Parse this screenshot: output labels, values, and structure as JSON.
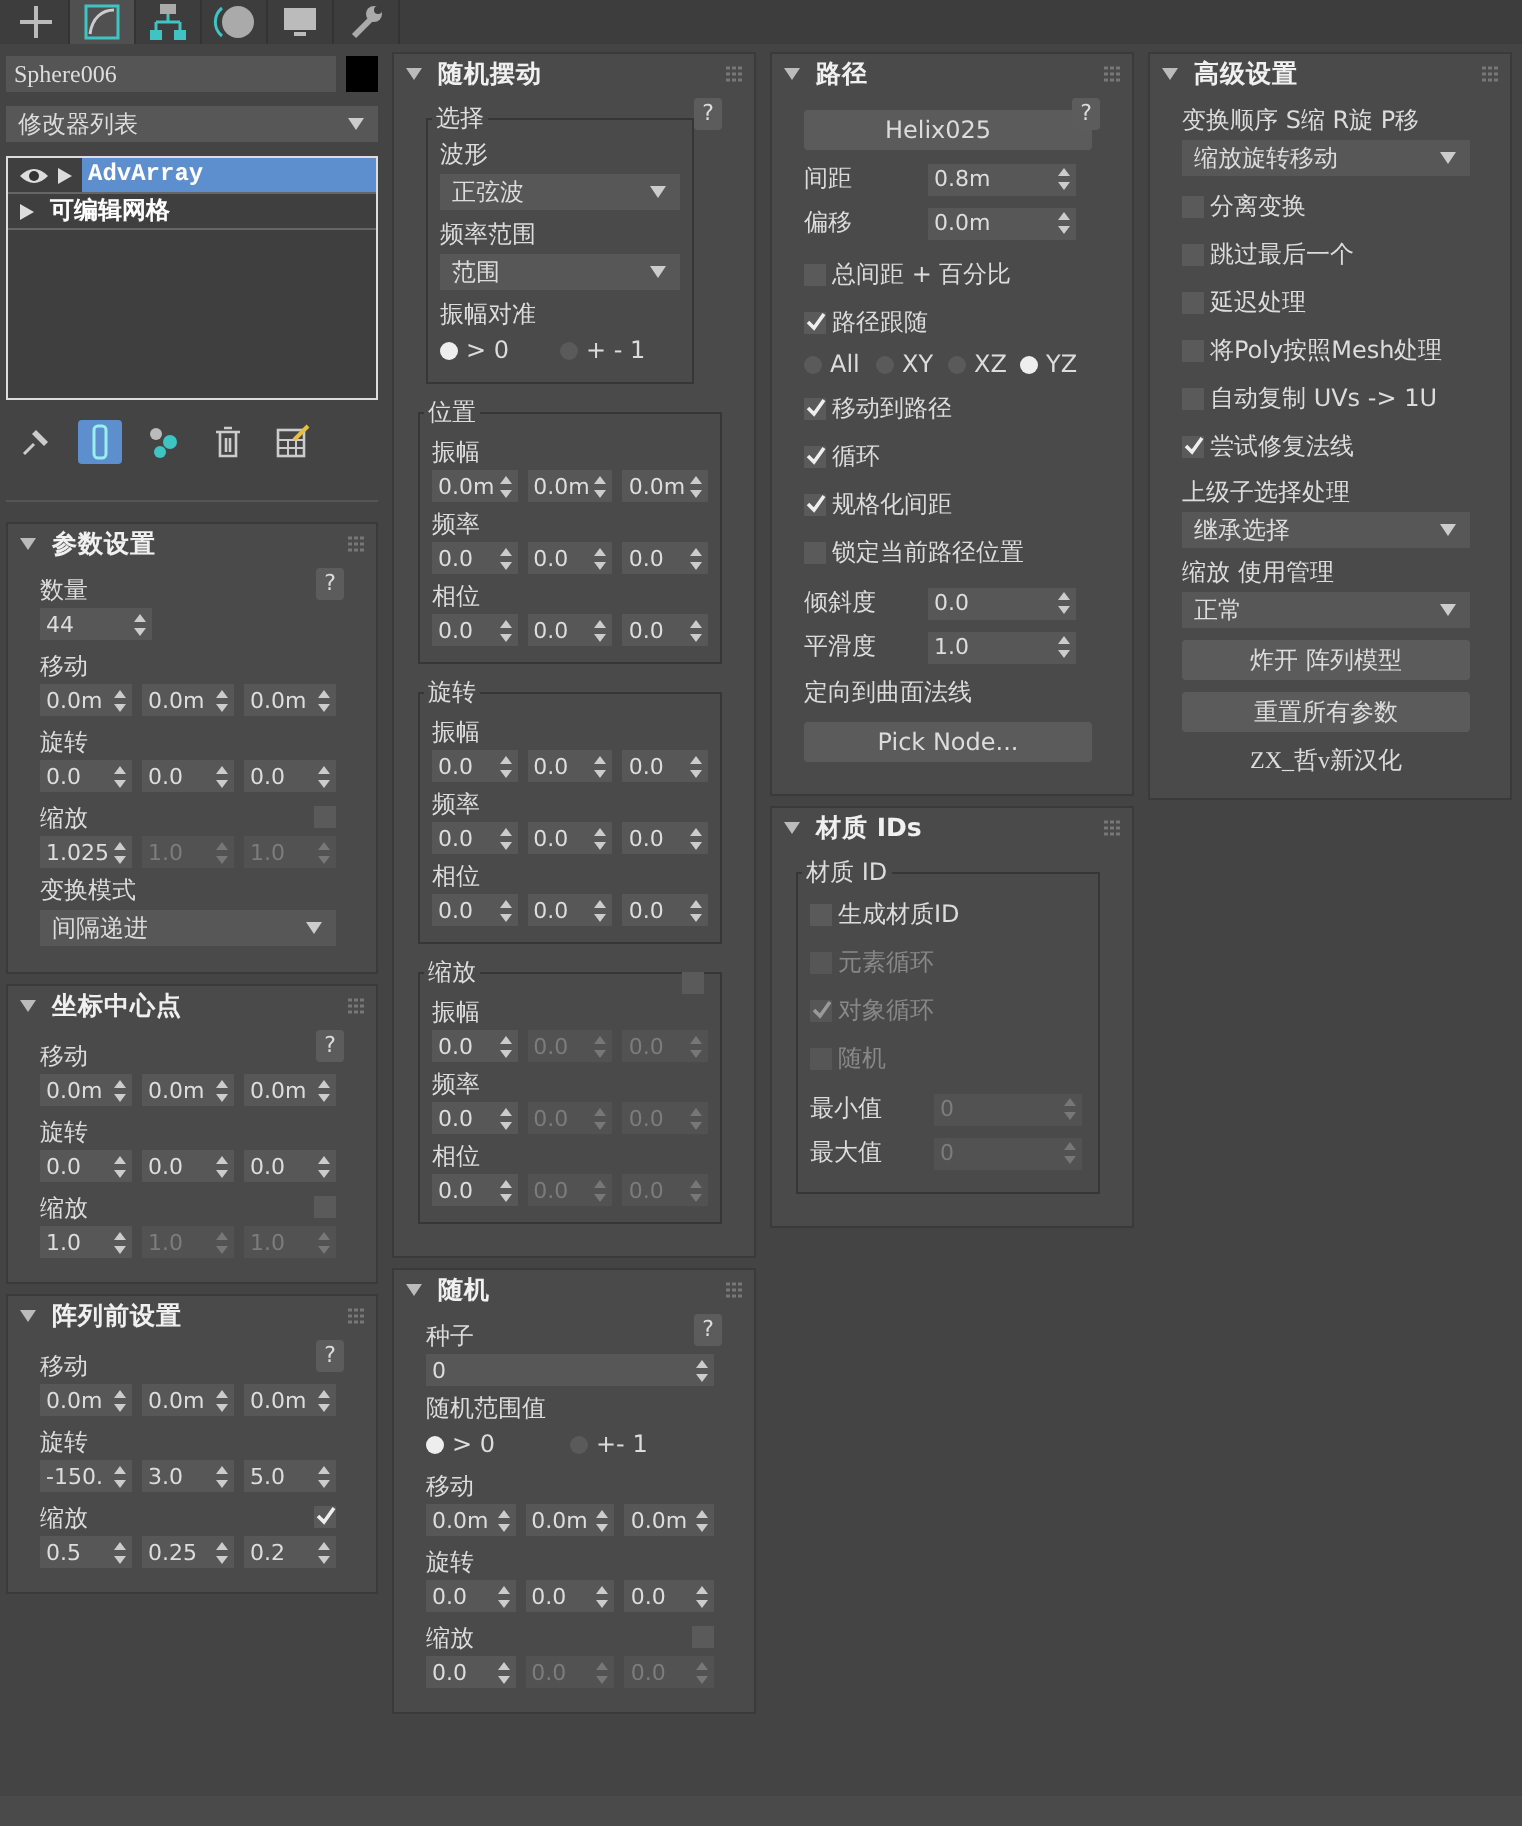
{
  "tabs": [
    {
      "kind": "create",
      "selected": false
    },
    {
      "kind": "modify",
      "selected": true
    },
    {
      "kind": "hierarchy",
      "selected": false
    },
    {
      "kind": "motion",
      "selected": false
    },
    {
      "kind": "display",
      "selected": false
    },
    {
      "kind": "utilities",
      "selected": false
    }
  ],
  "object_name": "Sphere006",
  "modifier_list": "修改器列表",
  "stack": [
    {
      "kind": "modifier",
      "label": "AdvArray",
      "selected": true
    },
    {
      "kind": "object",
      "label": "可编辑网格",
      "selected": false
    }
  ],
  "stack_tools": [
    {
      "kind": "pin",
      "on": false
    },
    {
      "kind": "end-result",
      "on": true
    },
    {
      "kind": "unique",
      "on": false
    },
    {
      "kind": "remove",
      "on": false
    },
    {
      "kind": "configure",
      "on": false
    }
  ],
  "columns": [
    {
      "rollouts": [
        {
          "title": "参数设置",
          "help": "?",
          "items": [
            {
              "kind": "spinner",
              "label": "数量",
              "value": "44"
            },
            {
              "kind": "spin3",
              "label": "移动",
              "fields": [
                {
                  "value": "0.0m",
                  "disabled": false
                },
                {
                  "value": "0.0m",
                  "disabled": false
                },
                {
                  "value": "0.0m",
                  "disabled": false
                }
              ]
            },
            {
              "kind": "spin3",
              "label": "旋转",
              "fields": [
                {
                  "value": "0.0",
                  "disabled": false
                },
                {
                  "value": "0.0",
                  "disabled": false
                },
                {
                  "value": "0.0",
                  "disabled": false
                }
              ]
            },
            {
              "kind": "spin3",
              "label": "缩放",
              "checked": false,
              "fields": [
                {
                  "value": "1.025",
                  "disabled": false
                },
                {
                  "value": "1.0",
                  "disabled": true
                },
                {
                  "value": "1.0",
                  "disabled": true
                }
              ]
            },
            {
              "kind": "dropdown",
              "label": "变换模式",
              "value": "间隔递进"
            }
          ]
        },
        {
          "title": "坐标中心点",
          "help": "?",
          "items": [
            {
              "kind": "spin3",
              "label": "移动",
              "fields": [
                {
                  "value": "0.0m",
                  "disabled": false
                },
                {
                  "value": "0.0m",
                  "disabled": false
                },
                {
                  "value": "0.0m",
                  "disabled": false
                }
              ]
            },
            {
              "kind": "spin3",
              "label": "旋转",
              "fields": [
                {
                  "value": "0.0",
                  "disabled": false
                },
                {
                  "value": "0.0",
                  "disabled": false
                },
                {
                  "value": "0.0",
                  "disabled": false
                }
              ]
            },
            {
              "kind": "spin3",
              "label": "缩放",
              "checked": false,
              "fields": [
                {
                  "value": "1.0",
                  "disabled": false
                },
                {
                  "value": "1.0",
                  "disabled": true
                },
                {
                  "value": "1.0",
                  "disabled": true
                }
              ]
            }
          ]
        },
        {
          "title": "阵列前设置",
          "help": "?",
          "items": [
            {
              "kind": "spin3",
              "label": "移动",
              "fields": [
                {
                  "value": "0.0m",
                  "disabled": false
                },
                {
                  "value": "0.0m",
                  "disabled": false
                },
                {
                  "value": "0.0m",
                  "disabled": false
                }
              ]
            },
            {
              "kind": "spin3",
              "label": "旋转",
              "fields": [
                {
                  "value": "-150.",
                  "disabled": false
                },
                {
                  "value": "3.0",
                  "disabled": false
                },
                {
                  "value": "5.0",
                  "disabled": false
                }
              ]
            },
            {
              "kind": "spin3",
              "label": "缩放",
              "checked": true,
              "fields": [
                {
                  "value": "0.5",
                  "disabled": false
                },
                {
                  "value": "0.25",
                  "disabled": false
                },
                {
                  "value": "0.2",
                  "disabled": false
                }
              ]
            }
          ]
        }
      ]
    },
    {
      "rollouts": [
        {
          "title": "随机摆动",
          "help": "?",
          "items": [
            {
              "kind": "group",
              "title": "选择",
              "items": [
                {
                  "kind": "label",
                  "text": "波形"
                },
                {
                  "kind": "dropdown",
                  "value": "正弦波"
                },
                {
                  "kind": "label",
                  "text": "频率范围"
                },
                {
                  "kind": "dropdown",
                  "value": "范围"
                },
                {
                  "kind": "label",
                  "text": "振幅对准"
                },
                {
                  "kind": "radios",
                  "options": [
                    {
                      "label": "> 0",
                      "selected": true
                    },
                    {
                      "label": "+ - 1",
                      "selected": false
                    }
                  ]
                }
              ]
            },
            {
              "kind": "group",
              "title": "位置",
              "items": [
                {
                  "kind": "spin3",
                  "label": "振幅",
                  "fields": [
                    {
                      "value": "0.0m",
                      "disabled": false
                    },
                    {
                      "value": "0.0m",
                      "disabled": false
                    },
                    {
                      "value": "0.0m",
                      "disabled": false
                    }
                  ]
                },
                {
                  "kind": "spin3",
                  "label": "频率",
                  "fields": [
                    {
                      "value": "0.0",
                      "disabled": false
                    },
                    {
                      "value": "0.0",
                      "disabled": false
                    },
                    {
                      "value": "0.0",
                      "disabled": false
                    }
                  ]
                },
                {
                  "kind": "spin3",
                  "label": "相位",
                  "fields": [
                    {
                      "value": "0.0",
                      "disabled": false
                    },
                    {
                      "value": "0.0",
                      "disabled": false
                    },
                    {
                      "value": "0.0",
                      "disabled": false
                    }
                  ]
                }
              ]
            },
            {
              "kind": "group",
              "title": "旋转",
              "items": [
                {
                  "kind": "spin3",
                  "label": "振幅",
                  "fields": [
                    {
                      "value": "0.0",
                      "disabled": false
                    },
                    {
                      "value": "0.0",
                      "disabled": false
                    },
                    {
                      "value": "0.0",
                      "disabled": false
                    }
                  ]
                },
                {
                  "kind": "spin3",
                  "label": "频率",
                  "fields": [
                    {
                      "value": "0.0",
                      "disabled": false
                    },
                    {
                      "value": "0.0",
                      "disabled": false
                    },
                    {
                      "value": "0.0",
                      "disabled": false
                    }
                  ]
                },
                {
                  "kind": "spin3",
                  "label": "相位",
                  "fields": [
                    {
                      "value": "0.0",
                      "disabled": false
                    },
                    {
                      "value": "0.0",
                      "disabled": false
                    },
                    {
                      "value": "0.0",
                      "disabled": false
                    }
                  ]
                }
              ]
            },
            {
              "kind": "group",
              "title": "缩放",
              "checked": false,
              "items": [
                {
                  "kind": "spin3",
                  "label": "振幅",
                  "fields": [
                    {
                      "value": "0.0",
                      "disabled": false
                    },
                    {
                      "value": "0.0",
                      "disabled": true
                    },
                    {
                      "value": "0.0",
                      "disabled": true
                    }
                  ]
                },
                {
                  "kind": "spin3",
                  "label": "频率",
                  "fields": [
                    {
                      "value": "0.0",
                      "disabled": false
                    },
                    {
                      "value": "0.0",
                      "disabled": true
                    },
                    {
                      "value": "0.0",
                      "disabled": true
                    }
                  ]
                },
                {
                  "kind": "spin3",
                  "label": "相位",
                  "fields": [
                    {
                      "value": "0.0",
                      "disabled": false
                    },
                    {
                      "value": "0.0",
                      "disabled": true
                    },
                    {
                      "value": "0.0",
                      "disabled": true
                    }
                  ]
                }
              ]
            }
          ]
        },
        {
          "title": "随机",
          "help": "?",
          "items": [
            {
              "kind": "spinner_wide",
              "label": "种子",
              "value": "0"
            },
            {
              "kind": "label",
              "text": "随机范围值"
            },
            {
              "kind": "radios",
              "options": [
                {
                  "label": "> 0",
                  "selected": true
                },
                {
                  "label": "+- 1",
                  "selected": false
                }
              ]
            },
            {
              "kind": "spin3",
              "label": "移动",
              "fields": [
                {
                  "value": "0.0m",
                  "disabled": false
                },
                {
                  "value": "0.0m",
                  "disabled": false
                },
                {
                  "value": "0.0m",
                  "disabled": false
                }
              ]
            },
            {
              "kind": "spin3",
              "label": "旋转",
              "fields": [
                {
                  "value": "0.0",
                  "disabled": false
                },
                {
                  "value": "0.0",
                  "disabled": false
                },
                {
                  "value": "0.0",
                  "disabled": false
                }
              ]
            },
            {
              "kind": "spin3",
              "label": "缩放",
              "checked": false,
              "fields": [
                {
                  "value": "0.0",
                  "disabled": false
                },
                {
                  "value": "0.0",
                  "disabled": true
                },
                {
                  "value": "0.0",
                  "disabled": true
                }
              ]
            }
          ]
        }
      ]
    },
    {
      "rollouts": [
        {
          "title": "路径",
          "help": "?",
          "items": [
            {
              "kind": "button",
              "label": "Helix025"
            },
            {
              "kind": "inline_spinner",
              "label": "间距",
              "value": "0.8m",
              "disabled": false
            },
            {
              "kind": "inline_spinner",
              "label": "偏移",
              "value": "0.0m",
              "disabled": false
            },
            {
              "kind": "checkbox",
              "label": "总间距 + 百分比",
              "checked": false,
              "disabled": false
            },
            {
              "kind": "checkbox",
              "label": "路径跟随",
              "checked": true,
              "disabled": false
            },
            {
              "kind": "radios",
              "options": [
                {
                  "label": "All",
                  "selected": false
                },
                {
                  "label": "XY",
                  "selected": false
                },
                {
                  "label": "XZ",
                  "selected": false
                },
                {
                  "label": "YZ",
                  "selected": true
                }
              ]
            },
            {
              "kind": "checkbox",
              "label": "移动到路径",
              "checked": true,
              "disabled": false
            },
            {
              "kind": "checkbox",
              "label": "循环",
              "checked": true,
              "disabled": false
            },
            {
              "kind": "checkbox",
              "label": "规格化间距",
              "checked": true,
              "disabled": false
            },
            {
              "kind": "checkbox",
              "label": "锁定当前路径位置",
              "checked": false,
              "disabled": false
            },
            {
              "kind": "inline_spinner",
              "label": "倾斜度",
              "value": "0.0",
              "disabled": false
            },
            {
              "kind": "inline_spinner",
              "label": "平滑度",
              "value": "1.0",
              "disabled": false
            },
            {
              "kind": "label",
              "text": "定向到曲面法线"
            },
            {
              "kind": "button",
              "label": "Pick Node..."
            }
          ]
        },
        {
          "title": "材质 IDs",
          "items": [
            {
              "kind": "group",
              "title": "材质 ID",
              "items": [
                {
                  "kind": "checkbox",
                  "label": "生成材质ID",
                  "checked": false,
                  "disabled": false
                },
                {
                  "kind": "checkbox",
                  "label": "元素循环",
                  "checked": false,
                  "disabled": true
                },
                {
                  "kind": "checkbox",
                  "label": "对象循环",
                  "checked": true,
                  "disabled": true
                },
                {
                  "kind": "checkbox",
                  "label": "随机",
                  "checked": false,
                  "disabled": true
                },
                {
                  "kind": "inline_spinner",
                  "label": "最小值",
                  "value": "0",
                  "disabled": true
                },
                {
                  "kind": "inline_spinner",
                  "label": "最大值",
                  "value": "0",
                  "disabled": true
                }
              ]
            }
          ]
        }
      ]
    },
    {
      "rollouts": [
        {
          "title": "高级设置",
          "items": [
            {
              "kind": "label",
              "text": "变换顺序 S缩 R旋 P移"
            },
            {
              "kind": "dropdown",
              "value": "缩放旋转移动"
            },
            {
              "kind": "checkbox",
              "label": "分离变换",
              "checked": false,
              "disabled": false
            },
            {
              "kind": "checkbox",
              "label": "跳过最后一个",
              "checked": false,
              "disabled": false
            },
            {
              "kind": "checkbox",
              "label": "延迟处理",
              "checked": false,
              "disabled": false
            },
            {
              "kind": "checkbox",
              "label": "将Poly按照Mesh处理",
              "checked": false,
              "disabled": false
            },
            {
              "kind": "checkbox",
              "label": "自动复制 UVs -> 1U",
              "checked": false,
              "disabled": false
            },
            {
              "kind": "checkbox",
              "label": "尝试修复法线",
              "checked": true,
              "disabled": false
            },
            {
              "kind": "dropdown",
              "label": "上级子选择处理",
              "value": "继承选择"
            },
            {
              "kind": "dropdown",
              "label": "缩放 使用管理",
              "value": "正常"
            },
            {
              "kind": "button",
              "label": "炸开 阵列模型"
            },
            {
              "kind": "button",
              "label": "重置所有参数"
            },
            {
              "kind": "note",
              "text": "ZX_哲v新汉化"
            }
          ]
        }
      ]
    }
  ]
}
